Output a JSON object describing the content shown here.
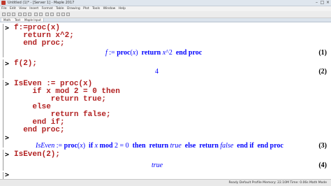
{
  "window": {
    "title": "Untitled (1)* - [Server 1] - Maple 2017"
  },
  "menu": [
    "File",
    "Edit",
    "View",
    "Insert",
    "Format",
    "Table",
    "Drawing",
    "Plot",
    "Tools",
    "Window",
    "Help"
  ],
  "tabs": [
    "Math",
    "Text",
    "Maple Input"
  ],
  "groups": [
    {
      "input": "f:=proc(x)\n  return x^2;\n  end proc;",
      "output_parts": [
        {
          "t": "f",
          "s": "i"
        },
        {
          "t": " := ",
          "s": ""
        },
        {
          "t": "proc",
          "s": "b"
        },
        {
          "t": "(",
          "s": ""
        },
        {
          "t": "x",
          "s": "i"
        },
        {
          "t": ")  ",
          "s": ""
        },
        {
          "t": "return",
          "s": "b"
        },
        {
          "t": " ",
          "s": ""
        },
        {
          "t": "x",
          "s": "i"
        },
        {
          "t": "^2  ",
          "s": ""
        },
        {
          "t": "end proc",
          "s": "b"
        }
      ],
      "label": "(1)"
    },
    {
      "input": "f(2);",
      "output_parts": [
        {
          "t": "4",
          "s": ""
        }
      ],
      "label": "(2)"
    },
    {
      "input": "IsEven := proc(x)\n    if x mod 2 = 0 then\n        return true;\n    else\n        return false;\n    end if;\n  end proc;",
      "output_parts": [],
      "label": ""
    },
    {
      "input": "",
      "output_parts": [
        {
          "t": "IsEven",
          "s": "i"
        },
        {
          "t": " := ",
          "s": ""
        },
        {
          "t": "proc",
          "s": "b"
        },
        {
          "t": "(",
          "s": ""
        },
        {
          "t": "x",
          "s": "i"
        },
        {
          "t": ")  ",
          "s": ""
        },
        {
          "t": "if",
          "s": "b"
        },
        {
          "t": " ",
          "s": ""
        },
        {
          "t": "x",
          "s": "i"
        },
        {
          "t": " ",
          "s": ""
        },
        {
          "t": "mod",
          "s": "b"
        },
        {
          "t": " 2 = 0  ",
          "s": ""
        },
        {
          "t": "then",
          "s": "b"
        },
        {
          "t": "  ",
          "s": ""
        },
        {
          "t": "return",
          "s": "b"
        },
        {
          "t": " ",
          "s": ""
        },
        {
          "t": "true",
          "s": "i"
        },
        {
          "t": "  ",
          "s": ""
        },
        {
          "t": "else",
          "s": "b"
        },
        {
          "t": "  ",
          "s": ""
        },
        {
          "t": "return",
          "s": "b"
        },
        {
          "t": " ",
          "s": ""
        },
        {
          "t": "false",
          "s": "i"
        },
        {
          "t": "  ",
          "s": ""
        },
        {
          "t": "end if",
          "s": "b"
        },
        {
          "t": "  ",
          "s": ""
        },
        {
          "t": "end proc",
          "s": "b"
        }
      ],
      "label": "(3)"
    },
    {
      "input": "IsEven(2);",
      "output_parts": [
        {
          "t": "true",
          "s": "i"
        }
      ],
      "label": "(4)"
    }
  ],
  "prompt_symbol": ">",
  "status": "Ready   Default Profile   Memory: 22.10M   Time: 0.06s   Math Mode"
}
